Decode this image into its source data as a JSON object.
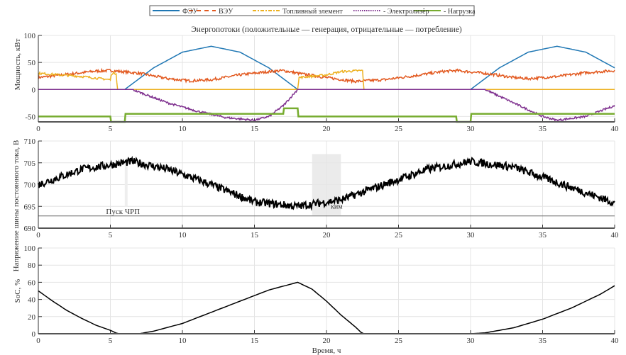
{
  "legend": [
    {
      "name": "ФЭУ",
      "color": "#1f77b4",
      "style": "solid"
    },
    {
      "name": "ВЭУ",
      "color": "#e2581e",
      "style": "dashed"
    },
    {
      "name": "Топливный элемент",
      "color": "#edb120",
      "style": "dashdot"
    },
    {
      "name": "- Электролизёр",
      "color": "#7e2f8e",
      "style": "dotted"
    },
    {
      "name": "- Нагрузка",
      "color": "#77ac30",
      "style": "solid"
    }
  ],
  "chart_data": [
    {
      "type": "line",
      "title": "Энергопотоки (положительные — генерация, отрицательные — потребление)",
      "xlabel": "",
      "ylabel": "Мощность, кВт",
      "xlim": [
        0,
        40
      ],
      "ylim": [
        -60,
        100
      ],
      "xticks": [
        0,
        5,
        10,
        15,
        20,
        25,
        30,
        35,
        40
      ],
      "yticks": [
        -50,
        0,
        50,
        100
      ],
      "grid": true,
      "series": [
        {
          "name": "ФЭУ",
          "points": [
            [
              0,
              0
            ],
            [
              6,
              0
            ],
            [
              8,
              40
            ],
            [
              10,
              69
            ],
            [
              12,
              80
            ],
            [
              14,
              69
            ],
            [
              16,
              40
            ],
            [
              18,
              0
            ],
            [
              30,
              0
            ],
            [
              32,
              40
            ],
            [
              34,
              69
            ],
            [
              36,
              80
            ],
            [
              38,
              69
            ],
            [
              40,
              40
            ]
          ]
        },
        {
          "name": "ВЭУ",
          "points": [
            [
              0,
              22
            ],
            [
              2,
              28
            ],
            [
              4,
              34
            ],
            [
              5,
              35
            ],
            [
              7,
              30
            ],
            [
              9,
              20
            ],
            [
              10.5,
              16
            ],
            [
              12,
              18
            ],
            [
              14,
              27
            ],
            [
              16,
              33
            ],
            [
              17,
              35
            ],
            [
              18,
              30
            ],
            [
              20,
              22
            ],
            [
              22,
              15
            ],
            [
              24,
              18
            ],
            [
              26,
              25
            ],
            [
              28,
              33
            ],
            [
              29,
              35
            ],
            [
              31,
              30
            ],
            [
              33,
              22
            ],
            [
              34,
              20
            ],
            [
              36,
              24
            ],
            [
              38,
              31
            ],
            [
              40,
              35
            ]
          ]
        },
        {
          "name": "Топливный элемент",
          "points": [
            [
              0,
              30
            ],
            [
              3,
              24
            ],
            [
              5,
              18
            ],
            [
              5.1,
              30
            ],
            [
              5.4,
              30
            ],
            [
              5.5,
              0
            ],
            [
              18,
              0
            ],
            [
              18.1,
              22
            ],
            [
              20,
              27
            ],
            [
              21,
              33
            ],
            [
              22.5,
              35
            ],
            [
              22.6,
              0
            ],
            [
              40,
              0
            ]
          ]
        },
        {
          "name": "- Электролизёр",
          "points": [
            [
              0,
              0
            ],
            [
              6.5,
              0
            ],
            [
              9,
              -25
            ],
            [
              11,
              -40
            ],
            [
              13,
              -52
            ],
            [
              15,
              -57
            ],
            [
              16,
              -50
            ],
            [
              17,
              -30
            ],
            [
              18,
              0
            ],
            [
              31,
              0
            ],
            [
              33,
              -25
            ],
            [
              35,
              -50
            ],
            [
              36,
              -57
            ],
            [
              38,
              -50
            ],
            [
              40,
              -30
            ]
          ]
        },
        {
          "name": "- Нагрузка",
          "points": [
            [
              0,
              -50
            ],
            [
              5,
              -50
            ],
            [
              5,
              -60
            ],
            [
              6,
              -60
            ],
            [
              6,
              -45
            ],
            [
              17,
              -45
            ],
            [
              17,
              -35
            ],
            [
              18,
              -35
            ],
            [
              18,
              -50
            ],
            [
              29,
              -50
            ],
            [
              29,
              -60
            ],
            [
              30,
              -60
            ],
            [
              30,
              -45
            ],
            [
              40,
              -45
            ]
          ]
        }
      ]
    },
    {
      "type": "line",
      "xlabel": "",
      "ylabel": "Напряжение шины постоянного тока, В",
      "xlim": [
        0,
        40
      ],
      "ylim": [
        690,
        710
      ],
      "xticks": [
        0,
        5,
        10,
        15,
        20,
        25,
        30,
        35,
        40
      ],
      "yticks": [
        690,
        695,
        700,
        705,
        710
      ],
      "grid": true,
      "series": [
        {
          "points": [
            [
              0,
              700
            ],
            [
              3,
              703.5
            ],
            [
              6.5,
              705.3
            ],
            [
              9,
              703.5
            ],
            [
              12,
              700
            ],
            [
              15,
              696
            ],
            [
              18,
              695
            ],
            [
              21,
              696.5
            ],
            [
              24,
              700
            ],
            [
              27,
              703.5
            ],
            [
              30,
              705.3
            ],
            [
              33,
              704
            ],
            [
              36,
              700.5
            ],
            [
              40,
              695.8
            ]
          ]
        }
      ],
      "threshold": {
        "value": 692.8,
        "label": "Пуск ЧРП"
      },
      "annotation": {
        "label": "ким",
        "x_range": [
          19,
          21
        ]
      }
    },
    {
      "type": "line",
      "xlabel": "Время, ч",
      "ylabel": "SoC, %",
      "xlim": [
        0,
        40
      ],
      "ylim": [
        0,
        100
      ],
      "xticks": [
        0,
        5,
        10,
        15,
        20,
        25,
        30,
        35,
        40
      ],
      "yticks": [
        0,
        20,
        40,
        60,
        80,
        100
      ],
      "grid": true,
      "series": [
        {
          "points": [
            [
              0,
              50
            ],
            [
              1,
              38
            ],
            [
              2,
              27
            ],
            [
              3,
              18
            ],
            [
              4,
              10
            ],
            [
              5,
              4
            ],
            [
              5.5,
              0
            ],
            [
              7,
              0
            ],
            [
              8,
              3
            ],
            [
              10,
              12
            ],
            [
              12,
              25
            ],
            [
              14,
              38
            ],
            [
              16,
              51
            ],
            [
              18,
              60
            ],
            [
              19,
              52
            ],
            [
              20,
              38
            ],
            [
              21,
              22
            ],
            [
              22,
              8
            ],
            [
              22.5,
              0
            ],
            [
              30,
              0
            ],
            [
              31,
              1
            ],
            [
              33,
              7
            ],
            [
              35,
              17
            ],
            [
              37,
              30
            ],
            [
              39,
              46
            ],
            [
              40,
              56
            ]
          ]
        }
      ]
    }
  ]
}
